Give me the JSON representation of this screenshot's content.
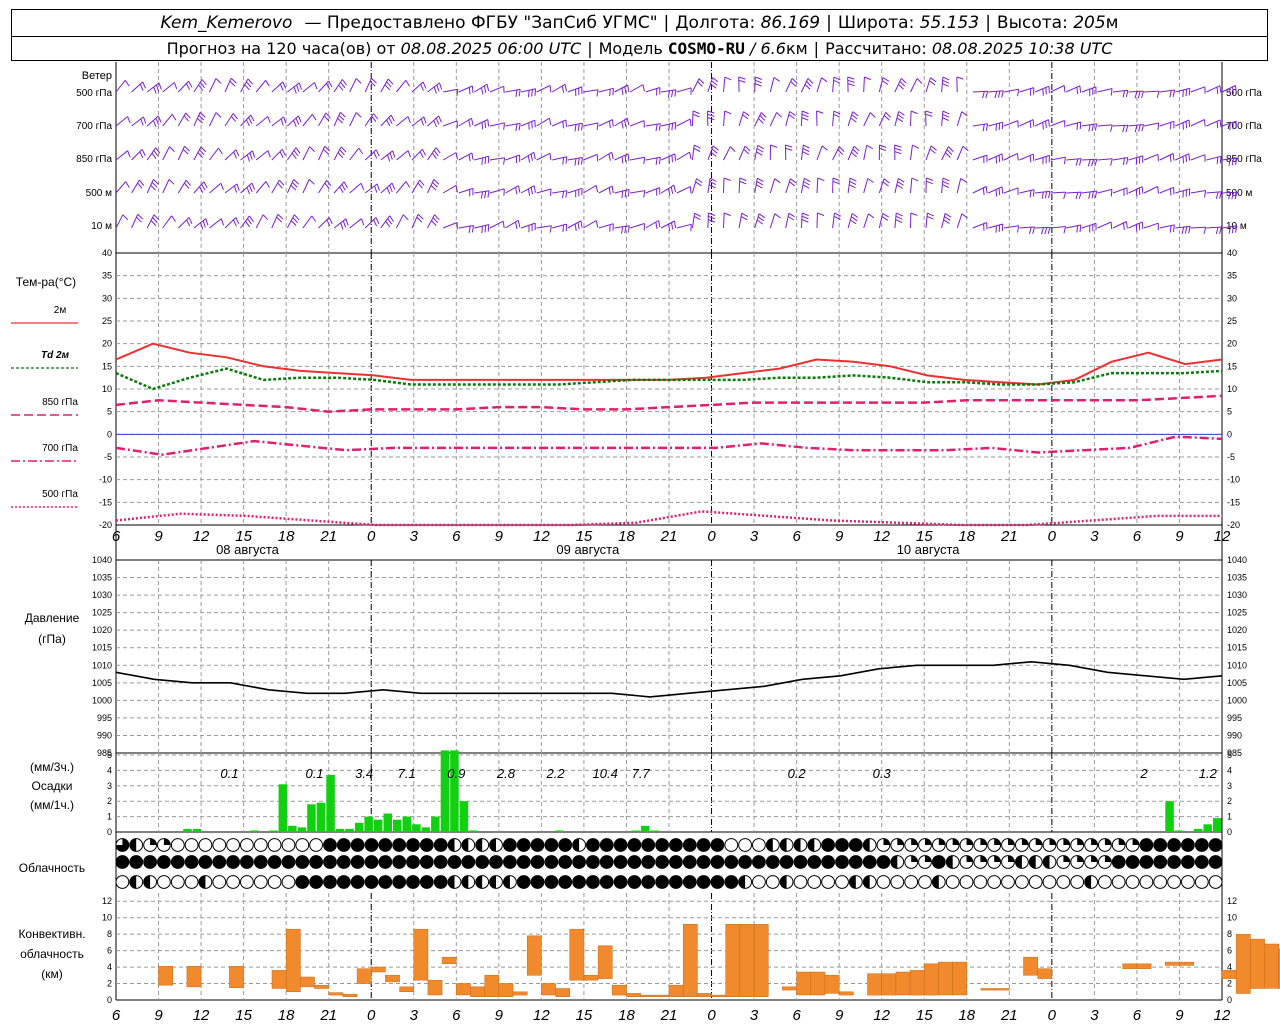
{
  "header": {
    "station": "Kem_Kemerovo",
    "provider": "— Предоставлено ФГБУ \"ЗапСиб УГМС\"",
    "lon_label": "Долгота:",
    "lon_value": "86.169",
    "lat_label": "Широта:",
    "lat_value": "55.153",
    "alt_label": "Высота:",
    "alt_value": "205",
    "alt_unit": "м",
    "forecast_text": "Прогноз на 120 часа(ов) от",
    "forecast_start": "08.08.2025 06:00 UTC",
    "model_label": "Модель",
    "model_name": "COSMO-RU",
    "model_res": "/ 6.6",
    "model_res_unit": "км",
    "computed_label": "Рассчитано:",
    "computed_value": "08.08.2025 10:38 UTC"
  },
  "labels": {
    "wind": "Ветер",
    "wind_levels": [
      "500 гПа",
      "700 гПа",
      "850 гПа",
      "500 м",
      "10 м"
    ],
    "temp": "Тем-ра(°C)",
    "temp_legend": [
      "2м",
      "Td 2м",
      "850 гПа",
      "700 гПа",
      "500 гПа"
    ],
    "pressure": [
      "Давление",
      "(гПа)"
    ],
    "precip": [
      "(мм/3ч.)",
      "Осадки",
      "(мм/1ч.)"
    ],
    "cloud": "Облачность",
    "conv": [
      "Конвективн.",
      "облачность",
      "(км)"
    ]
  },
  "colors": {
    "wind": "#7a1fd1",
    "t2m": "#ee3030",
    "td2m": "#0a7a0a",
    "t850": "#e0206f",
    "t700": "#e0206f",
    "t500": "#e0206f",
    "zero_line": "#2f3fd8",
    "pressure": "#000000",
    "precip": "#10d010",
    "conv": "#f08a2c",
    "grid": "#9a9a9a"
  },
  "time_axis": {
    "ticks": [
      "6",
      "9",
      "12",
      "15",
      "18",
      "21",
      "0",
      "3",
      "6",
      "9",
      "12",
      "15",
      "18",
      "21",
      "0",
      "3",
      "6",
      "9",
      "12",
      "15",
      "18",
      "21",
      "0",
      "3",
      "6",
      "9",
      "12"
    ],
    "days": [
      "08 августа",
      "09 августа",
      "10 августа"
    ]
  },
  "chart_data": [
    {
      "type": "line",
      "title": "Тем-ра(°C)",
      "ylim": [
        -20,
        40
      ],
      "yticks": [
        "40",
        "35",
        "30",
        "25",
        "20",
        "15",
        "10",
        "5",
        "0",
        "-5",
        "-10",
        "-15",
        "-20"
      ],
      "x_hours": [
        0,
        3,
        6,
        9,
        12,
        15,
        18,
        21,
        24,
        27,
        30,
        33,
        36,
        39,
        42,
        45,
        48,
        51,
        54,
        57,
        60,
        63,
        66,
        69,
        72,
        75,
        78
      ],
      "series": [
        {
          "name": "2м",
          "values": [
            16.5,
            20,
            18,
            17,
            15,
            14,
            13.5,
            13,
            12,
            12,
            12,
            12,
            12,
            12,
            12,
            12,
            12.5,
            13.5,
            14.5,
            16.5,
            16,
            15,
            13,
            12,
            11.5,
            11,
            12,
            16,
            18,
            15.5,
            16.5
          ]
        },
        {
          "name": "Td 2м",
          "values": [
            13.5,
            10,
            12.5,
            14.5,
            12,
            12.5,
            12.5,
            12,
            11,
            11,
            11,
            11,
            11,
            11.5,
            12,
            12,
            12,
            12,
            12.5,
            12.5,
            13,
            12.5,
            11.5,
            11.5,
            11,
            11,
            11.5,
            13.5,
            13.5,
            13.5,
            14
          ]
        },
        {
          "name": "850 гПа",
          "values": [
            6.5,
            7.5,
            7,
            6.5,
            6,
            5,
            5.5,
            5.5,
            5.5,
            6,
            6,
            5.5,
            5.5,
            6,
            6.5,
            7,
            7,
            7,
            7,
            7,
            7.5,
            7.5,
            7.5,
            7.5,
            7.5,
            8,
            8.5
          ]
        },
        {
          "name": "700 гПа",
          "values": [
            -3,
            -4.5,
            -3,
            -1.5,
            -2.5,
            -3.5,
            -3,
            -3,
            -3,
            -3,
            -3,
            -3,
            -3,
            -3,
            -2,
            -3,
            -3.5,
            -3.5,
            -3.5,
            -3,
            -4,
            -3.5,
            -3,
            -0.5,
            -1
          ]
        },
        {
          "name": "500 гПа",
          "values": [
            -19,
            -17.5,
            -18,
            -19,
            -20,
            -20,
            -20,
            -20,
            -19.5,
            -17,
            -18,
            -19,
            -19.5,
            -20,
            -20,
            -19,
            -18,
            -18
          ]
        }
      ]
    },
    {
      "type": "line",
      "title": "Давление",
      "ylim": [
        985,
        1040
      ],
      "yticks": [
        "1040",
        "1035",
        "1030",
        "1025",
        "1020",
        "1015",
        "1010",
        "1005",
        "1000",
        "995",
        "990",
        "985"
      ],
      "series": [
        {
          "name": "Давление",
          "values": [
            1008,
            1006,
            1005,
            1005,
            1003,
            1002,
            1002,
            1003,
            1002,
            1002,
            1002,
            1002,
            1002,
            1002,
            1001,
            1002,
            1003,
            1004,
            1006,
            1007,
            1009,
            1010,
            1010,
            1010,
            1011,
            1010,
            1008,
            1007,
            1006,
            1007
          ]
        }
      ]
    },
    {
      "type": "bar",
      "title": "Осадки",
      "ylim": [
        0,
        5
      ],
      "yticks": [
        "5",
        "4",
        "3",
        "2",
        "1",
        "0"
      ],
      "values_1h": [
        0,
        0,
        0,
        0,
        0,
        0,
        0,
        0.2,
        0.2,
        0,
        0,
        0,
        0,
        0,
        0.1,
        0,
        0.1,
        3.1,
        0.4,
        0.3,
        1.8,
        1.9,
        3.7,
        0.2,
        0.2,
        0.6,
        1.0,
        0.8,
        1.2,
        0.8,
        1.0,
        0.5,
        0.3,
        1.0,
        6.0,
        5.8,
        2.0,
        0.1,
        0,
        0,
        0,
        0,
        0,
        0,
        0,
        0,
        0.1,
        0,
        0,
        0,
        0,
        0,
        0,
        0,
        0.1,
        0.4,
        0.1,
        0,
        0,
        0,
        0,
        0,
        0,
        0,
        0,
        0,
        0,
        0,
        0,
        0,
        0,
        0,
        0,
        0,
        0,
        0,
        0,
        0,
        0,
        0,
        0,
        0,
        0,
        0,
        0,
        0,
        0,
        0,
        0,
        0,
        0,
        0,
        0,
        0,
        0,
        0,
        0,
        0,
        0,
        0,
        0,
        0,
        0,
        0,
        0,
        0,
        0,
        0,
        0,
        0,
        2.0,
        0.1,
        0,
        0.2,
        0.5,
        0.9
      ],
      "labels_3h": [
        "0.1",
        "0.1",
        "3.4",
        "7.1",
        "0.9",
        "2.8",
        "2.2",
        "10.4",
        "7.7",
        "0.2",
        "0.3",
        "2",
        "1.2"
      ]
    },
    {
      "type": "bar",
      "title": "Конвективн. облачность",
      "ylim": [
        0,
        13
      ],
      "yticks": [
        "12",
        "10",
        "8",
        "6",
        "4",
        "2",
        "0"
      ],
      "bars": [
        {
          "h": 4,
          "base": 1.8,
          "top": 4.1
        },
        {
          "h": 6,
          "base": 1.6,
          "top": 4.1
        },
        {
          "h": 9,
          "base": 1.5,
          "top": 4.1
        },
        {
          "h": 12,
          "base": 1.4,
          "top": 3.6
        },
        {
          "h": 13,
          "base": 1.0,
          "top": 8.6
        },
        {
          "h": 14,
          "base": 1.6,
          "top": 2.8
        },
        {
          "h": 15,
          "base": 1.4,
          "top": 1.8
        },
        {
          "h": 16,
          "base": 0.6,
          "top": 0.9
        },
        {
          "h": 17,
          "base": 0.4,
          "top": 0.7
        },
        {
          "h": 18,
          "base": 2.0,
          "top": 3.8
        },
        {
          "h": 19,
          "base": 3.4,
          "top": 4.0
        },
        {
          "h": 20,
          "base": 2.2,
          "top": 3.0
        },
        {
          "h": 21,
          "base": 1.0,
          "top": 1.6
        },
        {
          "h": 22,
          "base": 2.4,
          "top": 8.6
        },
        {
          "h": 23,
          "base": 0.6,
          "top": 2.4
        },
        {
          "h": 24,
          "base": 4.4,
          "top": 5.2
        },
        {
          "h": 25,
          "base": 0.6,
          "top": 2.0
        },
        {
          "h": 26,
          "base": 0.4,
          "top": 1.6
        },
        {
          "h": 27,
          "base": 0.4,
          "top": 3.0
        },
        {
          "h": 28,
          "base": 0.4,
          "top": 2.0
        },
        {
          "h": 29,
          "base": 0.6,
          "top": 1.0
        },
        {
          "h": 30,
          "base": 3.0,
          "top": 7.8
        },
        {
          "h": 31,
          "base": 0.6,
          "top": 2.0
        },
        {
          "h": 32,
          "base": 0.4,
          "top": 1.4
        },
        {
          "h": 33,
          "base": 2.4,
          "top": 8.6
        },
        {
          "h": 34,
          "base": 2.4,
          "top": 3.0
        },
        {
          "h": 35,
          "base": 2.6,
          "top": 6.6
        },
        {
          "h": 36,
          "base": 0.6,
          "top": 1.8
        },
        {
          "h": 37,
          "base": 0.4,
          "top": 0.8
        },
        {
          "h": 38,
          "base": 0.4,
          "top": 0.6
        },
        {
          "h": 39,
          "base": 0.4,
          "top": 0.6
        },
        {
          "h": 40,
          "base": 0.4,
          "top": 1.8
        },
        {
          "h": 41,
          "base": 0.4,
          "top": 9.2
        },
        {
          "h": 42,
          "base": 0.4,
          "top": 0.8
        },
        {
          "h": 43,
          "base": 0.4,
          "top": 0.6
        },
        {
          "h": 44,
          "base": 0.4,
          "top": 9.2
        },
        {
          "h": 45,
          "base": 0.4,
          "top": 9.2
        },
        {
          "h": 46,
          "base": 0.4,
          "top": 9.2
        },
        {
          "h": 48,
          "base": 1.2,
          "top": 1.6
        },
        {
          "h": 49,
          "base": 0.6,
          "top": 3.4
        },
        {
          "h": 50,
          "base": 0.6,
          "top": 3.4
        },
        {
          "h": 51,
          "base": 0.8,
          "top": 3.0
        },
        {
          "h": 52,
          "base": 0.6,
          "top": 1.0
        },
        {
          "h": 54,
          "base": 0.6,
          "top": 3.2
        },
        {
          "h": 55,
          "base": 0.6,
          "top": 3.2
        },
        {
          "h": 56,
          "base": 0.6,
          "top": 3.4
        },
        {
          "h": 57,
          "base": 0.6,
          "top": 3.6
        },
        {
          "h": 58,
          "base": 0.6,
          "top": 4.4
        },
        {
          "h": 59,
          "base": 0.6,
          "top": 4.6
        },
        {
          "h": 60,
          "base": 0.6,
          "top": 4.6
        },
        {
          "h": 62,
          "base": 1.2,
          "top": 1.4
        },
        {
          "h": 63,
          "base": 1.2,
          "top": 1.4
        },
        {
          "h": 65,
          "base": 3.0,
          "top": 5.2
        },
        {
          "h": 66,
          "base": 2.6,
          "top": 3.8
        },
        {
          "h": 72,
          "base": 3.8,
          "top": 4.4
        },
        {
          "h": 73,
          "base": 3.8,
          "top": 4.4
        },
        {
          "h": 75,
          "base": 4.2,
          "top": 4.6
        },
        {
          "h": 76,
          "base": 4.2,
          "top": 4.6
        },
        {
          "h": 79,
          "base": 2.6,
          "top": 3.6
        },
        {
          "h": 80,
          "base": 0.8,
          "top": 8.0
        },
        {
          "h": 81,
          "base": 1.4,
          "top": 7.4
        },
        {
          "h": 82,
          "base": 1.4,
          "top": 6.8
        },
        {
          "h": 83,
          "base": 1.4,
          "top": 6.2
        },
        {
          "h": 84,
          "base": 1.4,
          "top": 3.0
        },
        {
          "h": 85,
          "base": 1.0,
          "top": 6.8
        },
        {
          "h": 86,
          "base": 1.0,
          "top": 8.6
        },
        {
          "h": 87,
          "base": 1.0,
          "top": 8.6
        }
      ]
    }
  ],
  "cloud_rows": [
    "PHQQEEEEEEEEEEEFFFFFFFFFHHHHFFFFFHFFFFFFFFFFEEEHHHHFFFHQQQQQQQQQQQQQQQQQQQFFFFFFFFFFHFHHQEEQQEEEEEEEEEEEEEEEE",
    "FFFFFFFFFFFFFFFFFFFFFFFFFFFFFFFFFFFFFFFFFFFFFFFFFFFFFFFFHQQFHQQQQHHHQQQQFFFFFFFFFFFFFFFFFFFFFFFFFFFFFFFFFFFFFFFF",
    "EHHEEEHEEEEEEFFFFFFFFFFFHHHHHFFFFFFFFFFFFFFFFHEEHEEEEHHEEEEHEEEEEEEEEEHEEEEEEEEEEEEEEEEEEEEEEEEEEEEEEQFFHH"
  ]
}
